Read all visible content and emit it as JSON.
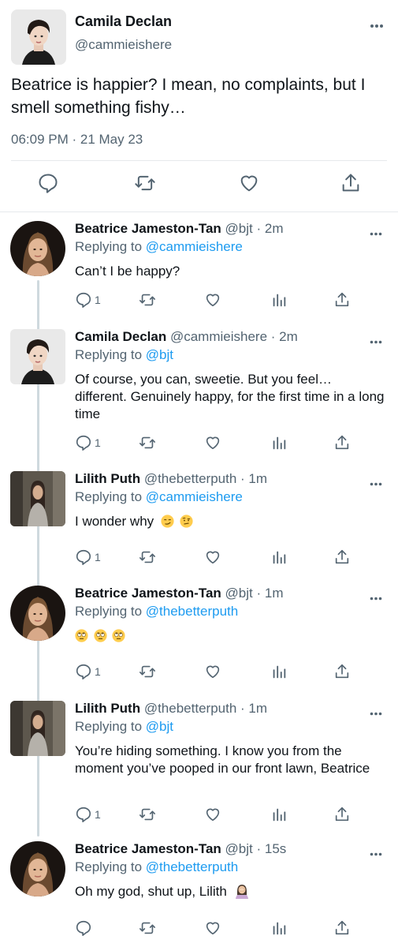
{
  "main_tweet": {
    "author_name": "Camila Declan",
    "author_handle": "@cammieishere",
    "text": "Beatrice is happier? I mean, no complaints, but I smell something fishy…",
    "timestamp": "06:09 PM · 21 May 23",
    "icons": [
      "reply-icon",
      "retweet-icon",
      "like-icon",
      "share-icon"
    ]
  },
  "replies": [
    {
      "name": "Beatrice Jameston-Tan",
      "meta": "@bjt · 2m",
      "replying_label": "Replying to ",
      "replying_to": "@cammieishere",
      "text": "Can’t I be happy?",
      "reply_count": "1"
    },
    {
      "name": "Camila Declan",
      "meta": "@cammieishere · 2m",
      "replying_label": "Replying to ",
      "replying_to": "@bjt",
      "text": "Of course, you can, sweetie. But you feel… different. Genuinely happy, for the first time in a long time",
      "reply_count": "1"
    },
    {
      "name": "Lilith Puth",
      "meta": "@thebetterputh · 1m",
      "replying_label": "Replying to ",
      "replying_to": "@cammieishere",
      "text": "I wonder why",
      "emojis": [
        "smirking-face-emoji",
        "face-with-raised-eyebrow-emoji"
      ],
      "reply_count": "1"
    },
    {
      "name": "Beatrice Jameston-Tan",
      "meta": "@bjt · 1m",
      "replying_label": "Replying to ",
      "replying_to": "@thebetterputh",
      "text": "",
      "emojis": [
        "rolling-eyes-emoji",
        "rolling-eyes-emoji",
        "rolling-eyes-emoji"
      ],
      "reply_count": "1"
    },
    {
      "name": "Lilith Puth",
      "meta": "@thebetterputh · 1m",
      "replying_label": "Replying to ",
      "replying_to": "@bjt",
      "text": "You’re hiding something. I know you from the moment you’ve pooped in our front lawn, Beatrice",
      "reply_count": "1"
    },
    {
      "name": "Beatrice Jameston-Tan",
      "meta": "@bjt · 15s",
      "replying_label": "Replying to ",
      "replying_to": "@thebetterputh",
      "text": "Oh my god, shut up, Lilith",
      "emojis": [
        "woman-facepalming-emoji"
      ],
      "reply_count": ""
    }
  ],
  "colors": {
    "text": "#0f1419",
    "muted": "#536471",
    "link": "#1d9bf0",
    "divider": "#e6e9ec",
    "thread_line": "#cfd9de"
  }
}
